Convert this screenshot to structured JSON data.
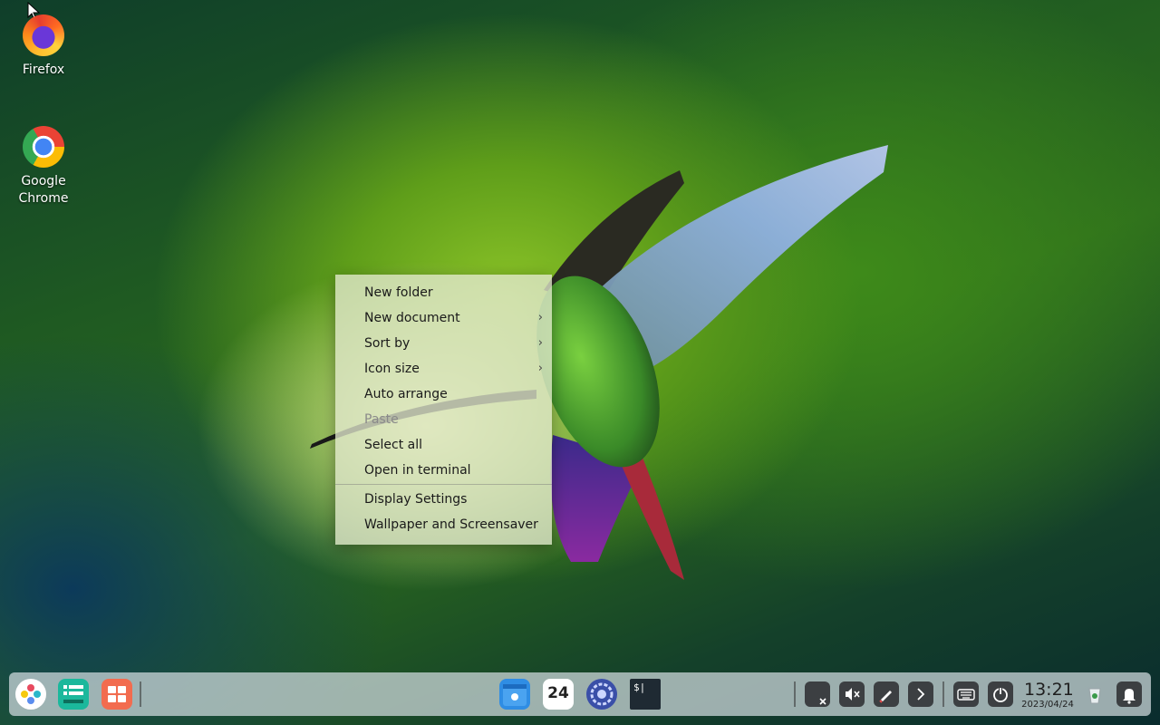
{
  "desktop": {
    "icons": [
      {
        "label": "Firefox"
      },
      {
        "label": "Google Chrome"
      }
    ]
  },
  "context_menu": {
    "items": [
      {
        "label": "New folder",
        "submenu": false,
        "enabled": true
      },
      {
        "label": "New document",
        "submenu": true,
        "enabled": true
      },
      {
        "label": "Sort by",
        "submenu": true,
        "enabled": true
      },
      {
        "label": "Icon size",
        "submenu": true,
        "enabled": true
      },
      {
        "label": "Auto arrange",
        "submenu": false,
        "enabled": true
      },
      {
        "label": "Paste",
        "submenu": false,
        "enabled": false
      },
      {
        "label": "Select all",
        "submenu": false,
        "enabled": true
      },
      {
        "label": "Open in terminal",
        "submenu": false,
        "enabled": true
      },
      {
        "label": "Display Settings",
        "submenu": false,
        "enabled": true
      },
      {
        "label": "Wallpaper and Screensaver",
        "submenu": false,
        "enabled": true
      }
    ],
    "submenu_glyph": "›"
  },
  "dock": {
    "calendar_day": "24",
    "terminal_glyph": "$|",
    "clock": {
      "time": "13:21",
      "date": "2023/04/24"
    },
    "icons": [
      "launcher-icon",
      "multitask-view-icon",
      "workspace-icon",
      "file-manager-icon",
      "calendar-icon",
      "control-center-icon",
      "terminal-icon",
      "screen-cast-icon",
      "volume-muted-icon",
      "pen-icon",
      "expand-tray-icon",
      "keyboard-icon",
      "power-icon",
      "trash-icon",
      "notification-icon"
    ]
  }
}
